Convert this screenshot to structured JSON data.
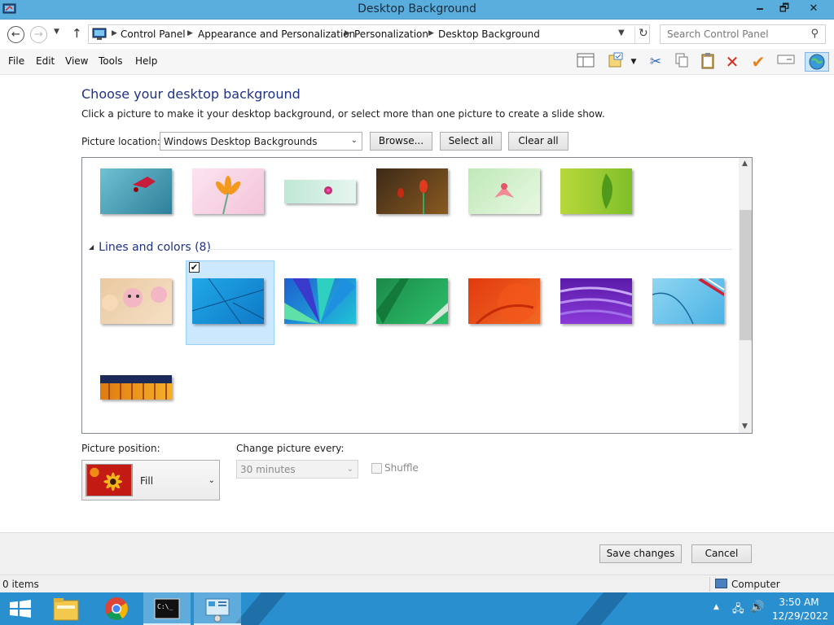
{
  "window": {
    "title": "Desktop Background",
    "minimize_glyph": "🗕",
    "maximize_glyph": "🗗",
    "close_glyph": "✕"
  },
  "address_bar": {
    "crumbs": [
      "Control Panel",
      "Appearance and Personalization",
      "Personalization",
      "Desktop Background"
    ]
  },
  "search": {
    "placeholder": "Search Control Panel"
  },
  "menu": [
    "File",
    "Edit",
    "View",
    "Tools",
    "Help"
  ],
  "toolbar_icons": [
    "layout-icon",
    "properties-icon",
    "cut-icon",
    "copy-icon",
    "paste-icon",
    "delete-icon",
    "checkmark-icon",
    "rename-icon",
    "globe-icon"
  ],
  "content": {
    "heading": "Choose your desktop background",
    "subtext": "Click a picture to make it your desktop background, or select more than one picture to create a slide show.",
    "location_label": "Picture location:",
    "location_value": "Windows Desktop Backgrounds",
    "browse_label": "Browse...",
    "select_all_label": "Select all",
    "clear_all_label": "Clear all"
  },
  "gallery": {
    "group_title": "Lines and colors (8)",
    "selected_index_in_group": 1
  },
  "options": {
    "position_label": "Picture position:",
    "position_value": "Fill",
    "change_label": "Change picture every:",
    "change_value": "30 minutes",
    "shuffle_label": "Shuffle",
    "shuffle_checked": false
  },
  "buttons": {
    "save": "Save changes",
    "cancel": "Cancel"
  },
  "status": {
    "items": "0 items",
    "location": "Computer"
  },
  "taskbar": {
    "time": "3:50 AM",
    "date": "12/29/2022"
  },
  "colors": {
    "titlebar": "#5aaede",
    "taskbar": "#2a8fcf",
    "heading": "#1e3287",
    "selection": "#cce8ff"
  }
}
